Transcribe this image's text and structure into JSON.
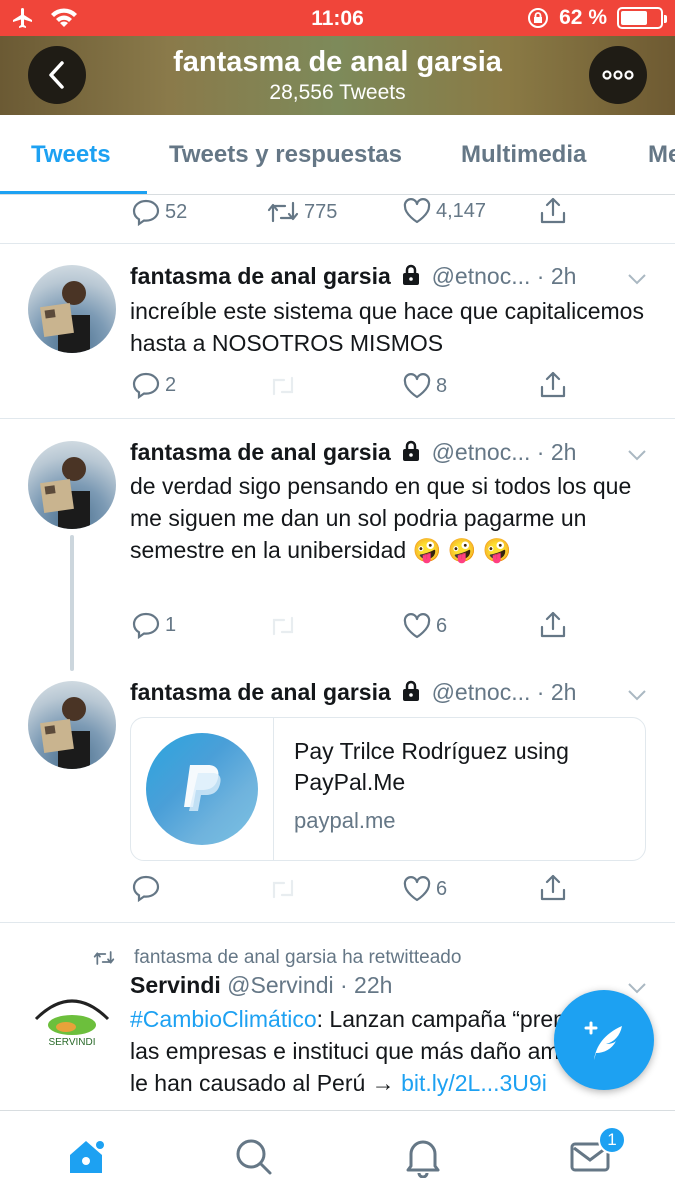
{
  "status_bar": {
    "time": "11:06",
    "battery": "62 %"
  },
  "profile": {
    "name": "fantasma de anal garsia",
    "tweet_count": "28,556 Tweets"
  },
  "tabs": [
    {
      "label": "Tweets",
      "active": true
    },
    {
      "label": "Tweets y respuestas",
      "active": false
    },
    {
      "label": "Multimedia",
      "active": false
    },
    {
      "label": "Me",
      "active": false
    }
  ],
  "top_actions": {
    "replies": "52",
    "retweets": "775",
    "likes": "4,147"
  },
  "tweets": [
    {
      "name": "fantasma de anal garsia",
      "handle": "@etnoc...",
      "time": "· 2h",
      "text": "increíble este sistema que hace que capitalicemos hasta a NOSOTROS MISMOS",
      "replies": "2",
      "likes": "8"
    },
    {
      "name": "fantasma de anal garsia",
      "handle": "@etnoc...",
      "time": "· 2h",
      "text": "de verdad sigo pensando en que si todos los que me siguen me dan un sol podria pagarme un semestre en la unibersidad 🤪 🤪 🤪",
      "replies": "1",
      "likes": "6"
    },
    {
      "name": "fantasma de anal garsia",
      "handle": "@etnoc...",
      "time": "· 2h",
      "card": {
        "title": "Pay Trilce Rodríguez using PayPal.Me",
        "domain": "paypal.me"
      },
      "likes": "6"
    },
    {
      "retweeted_by": "fantasma de anal garsia ha retwitteado",
      "name": "Servindi",
      "handle": "@Servindi",
      "time": "· 22h",
      "hashtag": "#CambioClimático",
      "text": ": Lanzan campaña “premiará” a las empresas e instituci que más daño ambiental le han causado al Perú →",
      "link": "bit.ly/2L...3U9i",
      "avatar_label": "SERVINDI"
    }
  ],
  "nav": {
    "messages_badge": "1"
  },
  "colors": {
    "accent": "#1da1f2",
    "status_bar": "#f0453a",
    "secondary_text": "#657786"
  }
}
